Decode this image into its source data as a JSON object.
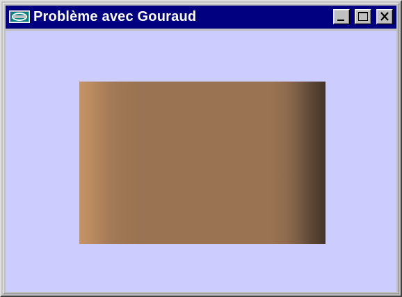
{
  "window": {
    "title": "Problème avec Gouraud",
    "icon": "app-window-icon"
  },
  "title_buttons": {
    "minimize_icon": "minimize-icon",
    "maximize_icon": "maximize-icon",
    "close_icon": "close-icon"
  },
  "canvas": {
    "background_color": "#ccccff",
    "shape": "rectangle",
    "shading": "Gouraud gradient",
    "gradient_colors": [
      "#c49466",
      "#997352",
      "#433427"
    ]
  }
}
